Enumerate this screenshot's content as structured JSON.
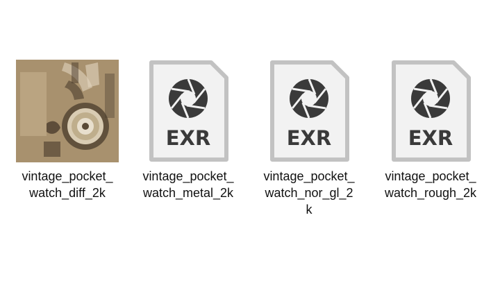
{
  "files": [
    {
      "name": "vintage_pocket_watch_diff_2k",
      "line1": "vintage_pocket_",
      "line2": "watch_diff_2k",
      "line3": "",
      "thumbnail": "texture-image"
    },
    {
      "name": "vintage_pocket_watch_metal_2k",
      "line1": "vintage_pocket_",
      "line2": "watch_metal_2k",
      "line3": "",
      "icon": "exr-file-icon",
      "icon_label": "EXR"
    },
    {
      "name": "vintage_pocket_watch_nor_gl_2k",
      "line1": "vintage_pocket_",
      "line2": "watch_nor_gl_2",
      "line3": "k",
      "icon": "exr-file-icon",
      "icon_label": "EXR"
    },
    {
      "name": "vintage_pocket_watch_rough_2k",
      "line1": "vintage_pocket_",
      "line2": "watch_rough_2k",
      "line3": "",
      "icon": "exr-file-icon",
      "icon_label": "EXR"
    }
  ],
  "colors": {
    "icon_fill": "#f2f2f2",
    "icon_stroke": "#c2c2c2",
    "icon_glyph": "#3a3a3a",
    "texture_base": "#a08a67"
  }
}
